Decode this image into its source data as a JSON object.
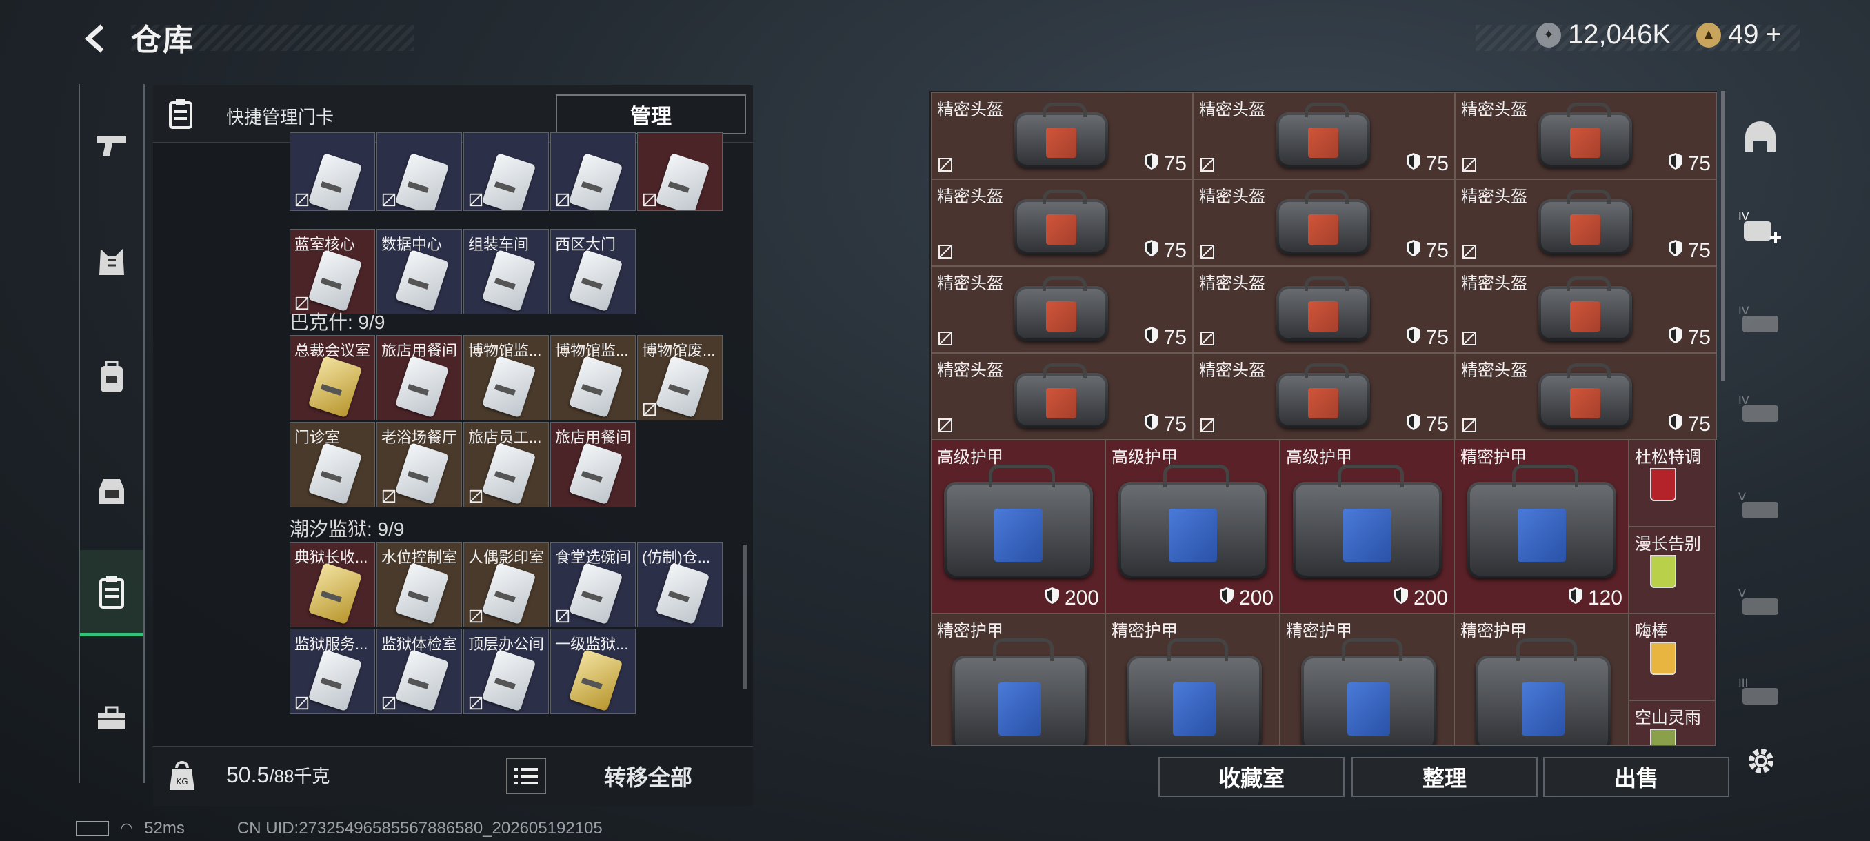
{
  "header": {
    "title": "仓库",
    "currency_main": "12,046K",
    "currency_secondary": "49",
    "currency_secondary_plus": "+"
  },
  "nav": {
    "items": [
      {
        "name": "weapon",
        "icon": "pistol-icon"
      },
      {
        "name": "armor",
        "icon": "vest-icon"
      },
      {
        "name": "backpack",
        "icon": "backpack-icon"
      },
      {
        "name": "chest-rig",
        "icon": "rig-icon"
      },
      {
        "name": "keycard",
        "icon": "keycard-icon",
        "active": true
      },
      {
        "name": "toolbox",
        "icon": "toolbox-icon"
      }
    ]
  },
  "left_panel": {
    "quick_label": "快捷管理门卡",
    "manage_label": "管理",
    "groups": [
      {
        "title": "",
        "cards": [
          {
            "label": "",
            "bg": "navy",
            "nodrop": true
          },
          {
            "label": "",
            "bg": "navy",
            "nodrop": true
          },
          {
            "label": "",
            "bg": "navy",
            "nodrop": true
          },
          {
            "label": "",
            "bg": "navy",
            "nodrop": true
          },
          {
            "label": "",
            "bg": "red",
            "nodrop": true
          },
          {
            "label": "蓝室核心",
            "bg": "red",
            "nodrop": true
          },
          {
            "label": "数据中心",
            "bg": "navy",
            "nodrop": false
          },
          {
            "label": "组装车间",
            "bg": "navy",
            "nodrop": false
          },
          {
            "label": "西区大门",
            "bg": "navy",
            "nodrop": false
          }
        ]
      },
      {
        "title": "巴克什: 9/9",
        "cards": [
          {
            "label": "总裁会议室",
            "bg": "red",
            "nodrop": false,
            "gold": true
          },
          {
            "label": "旅店用餐间",
            "bg": "red",
            "nodrop": false
          },
          {
            "label": "博物馆监...",
            "bg": "brown",
            "nodrop": false
          },
          {
            "label": "博物馆监...",
            "bg": "brown",
            "nodrop": false
          },
          {
            "label": "博物馆废...",
            "bg": "brown",
            "nodrop": true
          },
          {
            "label": "门诊室",
            "bg": "brown",
            "nodrop": false
          },
          {
            "label": "老浴场餐厅",
            "bg": "brown",
            "nodrop": true
          },
          {
            "label": "旅店员工...",
            "bg": "brown",
            "nodrop": true
          },
          {
            "label": "旅店用餐间",
            "bg": "red",
            "nodrop": false
          }
        ]
      },
      {
        "title": "潮汐监狱: 9/9",
        "cards": [
          {
            "label": "典狱长收...",
            "bg": "red",
            "nodrop": false,
            "gold": true
          },
          {
            "label": "水位控制室",
            "bg": "brown",
            "nodrop": false
          },
          {
            "label": "人偶影印室",
            "bg": "brown",
            "nodrop": true
          },
          {
            "label": "食堂选碗间",
            "bg": "navy",
            "nodrop": true
          },
          {
            "label": "(仿制)仓...",
            "bg": "navy",
            "nodrop": false
          },
          {
            "label": "监狱服务...",
            "bg": "navy",
            "nodrop": true
          },
          {
            "label": "监狱体检室",
            "bg": "navy",
            "nodrop": true
          },
          {
            "label": "顶层办公间",
            "bg": "navy",
            "nodrop": true
          },
          {
            "label": "一级监狱...",
            "bg": "navy",
            "nodrop": false,
            "gold": true
          }
        ]
      }
    ],
    "weight_current": "50.5",
    "weight_max": "/88千克",
    "transfer_label": "转移全部"
  },
  "right_panel": {
    "helmets": [
      {
        "label": "精密头盔",
        "value": "75"
      },
      {
        "label": "精密头盔",
        "value": "75"
      },
      {
        "label": "精密头盔",
        "value": "75"
      },
      {
        "label": "精密头盔",
        "value": "75"
      },
      {
        "label": "精密头盔",
        "value": "75"
      },
      {
        "label": "精密头盔",
        "value": "75"
      },
      {
        "label": "精密头盔",
        "value": "75"
      },
      {
        "label": "精密头盔",
        "value": "75"
      },
      {
        "label": "精密头盔",
        "value": "75"
      },
      {
        "label": "精密头盔",
        "value": "75"
      },
      {
        "label": "精密头盔",
        "value": "75"
      },
      {
        "label": "精密头盔",
        "value": "75"
      }
    ],
    "armors": [
      {
        "label": "高级护甲",
        "value": "200"
      },
      {
        "label": "高级护甲",
        "value": "200"
      },
      {
        "label": "高级护甲",
        "value": "200"
      },
      {
        "label": "精密护甲",
        "value": "120"
      }
    ],
    "armors_row2": [
      {
        "label": "精密护甲"
      },
      {
        "label": "精密护甲"
      },
      {
        "label": "精密护甲"
      },
      {
        "label": "精密护甲"
      }
    ],
    "drinks": [
      {
        "label": "杜松特调"
      },
      {
        "label": "漫长告别"
      },
      {
        "label": "嗨棒"
      },
      {
        "label": "空山灵雨"
      }
    ],
    "buttons": {
      "collection": "收藏室",
      "sort": "整理",
      "sell": "出售"
    }
  },
  "side_strip": {
    "icons": [
      "helmet-slot-icon",
      "add-armor-icon",
      "tier4-armor-icon",
      "tier4-rig-icon",
      "tier5-armor-icon",
      "tier5-rig-icon",
      "tier3-armor-icon",
      "settings-icon"
    ]
  },
  "status": {
    "ping": "52ms",
    "uid": "CN UID:27325496585567886580_202605192105"
  },
  "colors": {
    "accent": "#34c27a",
    "armor_bg": "#5a2228",
    "helmet_bg": "#4a3430"
  }
}
